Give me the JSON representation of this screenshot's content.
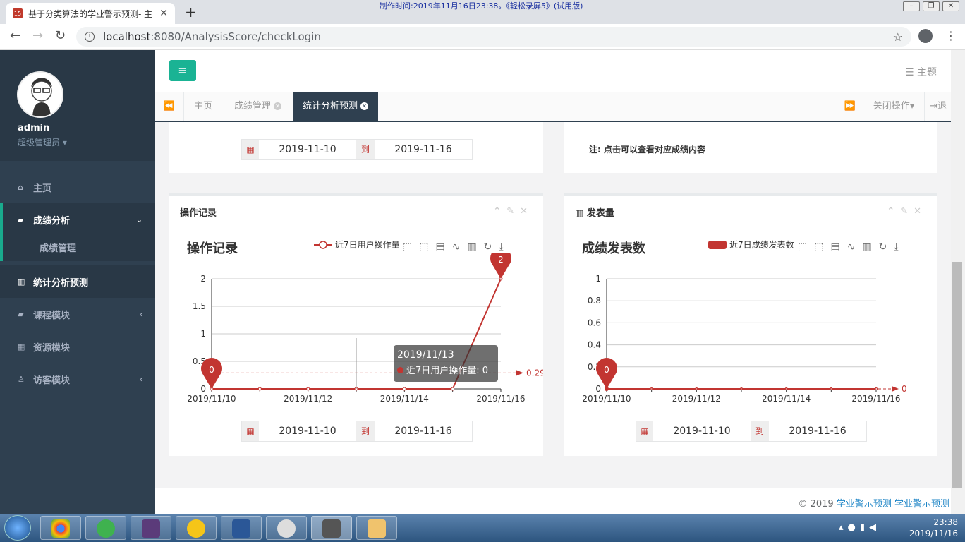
{
  "browser": {
    "tab_title": "基于分类算法的学业警示预测- 主",
    "tab_close": "✕",
    "new_tab": "+",
    "favicon_text": "15",
    "watermark": "制作时间:2019年11月16日23:38。《轻松录屏5》(试用版)",
    "url_host": "localhost",
    "url_rest": ":8080/AnalysisScore/checkLogin"
  },
  "sidebar": {
    "username": "admin",
    "role": "超级管理员",
    "items": [
      {
        "label": "主页",
        "icon": "home-icon"
      },
      {
        "label": "成绩分析",
        "icon": "book-icon"
      },
      {
        "label": "成绩管理"
      },
      {
        "label": "统计分析预测",
        "icon": "bar-chart-icon"
      },
      {
        "label": "课程模块",
        "icon": "book-icon"
      },
      {
        "label": "资源模块",
        "icon": "table-icon"
      },
      {
        "label": "访客模块",
        "icon": "user-icon"
      }
    ]
  },
  "topbar": {
    "theme_label": "主题"
  },
  "tabs": {
    "home": "主页",
    "pages": [
      {
        "label": "成绩管理"
      },
      {
        "label": "统计分析预测"
      }
    ],
    "close_ops": "关闭操作",
    "logout": "退出"
  },
  "top_left_box": {
    "date_from": "2019-11-10",
    "date_sep": "到",
    "date_to": "2019-11-16"
  },
  "top_right_box": {
    "note": "注: 点击可以查看对应成绩内容"
  },
  "ops_box": {
    "header": "操作记录",
    "chart_title": "操作记录",
    "legend": "近7日用户操作量",
    "date_from": "2019-11-10",
    "date_sep": "到",
    "date_to": "2019-11-16",
    "tooltip_date": "2019/11/13",
    "tooltip_value": "近7日用户操作量: 0"
  },
  "pub_box": {
    "header": "发表量",
    "chart_title": "成绩发表数",
    "legend": "近7日成绩发表数",
    "date_from": "2019-11-10",
    "date_sep": "到",
    "date_to": "2019-11-16"
  },
  "footer": {
    "copyright": "© 2019",
    "link1": "学业警示预测",
    "link2": "学业警示预测"
  },
  "taskbar": {
    "time": "23:38",
    "date": "2019/11/16"
  },
  "colors": {
    "accent": "#1ab394",
    "series": "#c23531",
    "sidebar": "#2f4050"
  },
  "chart_data": [
    {
      "type": "line",
      "title": "操作记录",
      "categories": [
        "2019/11/10",
        "2019/11/11",
        "2019/11/12",
        "2019/11/13",
        "2019/11/14",
        "2019/11/15",
        "2019/11/16"
      ],
      "x_tick_labels": [
        "2019/11/10",
        "2019/11/12",
        "2019/11/14",
        "2019/11/16"
      ],
      "series": [
        {
          "name": "近7日用户操作量",
          "values": [
            0,
            0,
            0,
            0,
            0,
            0,
            2
          ]
        }
      ],
      "ylim": [
        0,
        2
      ],
      "y_ticks": [
        "0",
        "0.5",
        "1",
        "1.5",
        "2"
      ],
      "mark_points": [
        {
          "label": "0",
          "category": "2019/11/10",
          "value": 0
        },
        {
          "label": "2",
          "category": "2019/11/16",
          "value": 2
        }
      ],
      "mark_line": {
        "label": "0.29",
        "value": 0.29
      },
      "grid": true,
      "legend_position": "top-right"
    },
    {
      "type": "line",
      "title": "成绩发表数",
      "categories": [
        "2019/11/10",
        "2019/11/11",
        "2019/11/12",
        "2019/11/13",
        "2019/11/14",
        "2019/11/15",
        "2019/11/16"
      ],
      "x_tick_labels": [
        "2019/11/10",
        "2019/11/12",
        "2019/11/14",
        "2019/11/16"
      ],
      "series": [
        {
          "name": "近7日成绩发表数",
          "values": [
            0,
            0,
            0,
            0,
            0,
            0,
            0
          ]
        }
      ],
      "ylim": [
        0,
        1
      ],
      "y_ticks": [
        "0",
        "0.2",
        "0.4",
        "0.6",
        "0.8",
        "1"
      ],
      "mark_points": [
        {
          "label": "0",
          "category": "2019/11/10",
          "value": 0
        }
      ],
      "mark_line": {
        "label": "0",
        "value": 0
      },
      "grid": true,
      "legend_position": "top-right"
    }
  ]
}
